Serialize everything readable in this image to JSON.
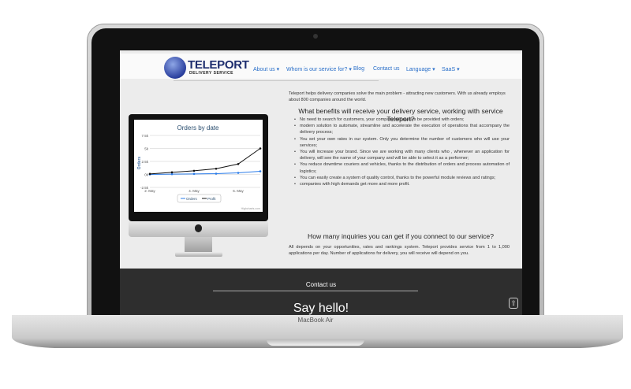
{
  "device": {
    "label": "MacBook Air"
  },
  "nav": {
    "logo_title": "TELEPORT",
    "logo_subtitle": "DELIVERY SERVICE",
    "items": [
      {
        "label": "About us ▾"
      },
      {
        "label": "Whom is our service for? ▾"
      },
      {
        "label": "Blog"
      },
      {
        "label": "Contact us"
      },
      {
        "label": "Language ▾"
      },
      {
        "label": "SaaS ▾"
      }
    ]
  },
  "intro": "Teleport helps delivery companies solve the main problem - attracting new customers. With us already employs about 800 companies around the world.",
  "benefits_heading": "What benefits will receive your delivery service, working with service Teleport?",
  "benefits": [
    "No need to search for customers, your company will always be provided with orders;",
    "modern solution to automate, streamline and accelerate the execution of operations that accompany the delivery process;",
    "You set your own rates in our system. Only you determine the number of customers who will use your services;",
    "You will increase your brand. Since we are working with many clients who , whenever an application for delivery, will see the name of your company and will be able to select it as a performer;",
    "You reduce downtime couriers and vehicles, thanks to the distribution of orders and process automation of logistics;",
    "You can easily create a system of quality control, thanks to the powerful module reviews and ratings;",
    "companies with high demands get more and more profit."
  ],
  "inquiries_heading": "How many inquiries you can get if you connect to our service?",
  "inquiries_text": "All depends on your opportunities, rates and rankings system. Teleport provides service from 1 to 1,000 applications per day. Number of applications for delivery, you will receive will depend on you.",
  "footer": {
    "title": "Contact us",
    "headline": "Say hello!"
  },
  "chart_data": {
    "type": "line",
    "title": "Orders by date",
    "ylabel": "Orders",
    "ylim": [
      -2500,
      7500
    ],
    "yticks": [
      "7.5k",
      "5k",
      "2.5k",
      "0k",
      "-2.5k"
    ],
    "xticks": [
      "2. May",
      "4. May",
      "6. May"
    ],
    "x": [
      "2. May",
      "3. May",
      "4. May",
      "5. May",
      "6. May",
      "7. May"
    ],
    "series": [
      {
        "name": "Orders",
        "color": "#2b7ce9",
        "values": [
          0,
          50,
          100,
          150,
          300,
          600
        ]
      },
      {
        "name": "Profit",
        "color": "#111111",
        "values": [
          100,
          400,
          700,
          1100,
          2000,
          5000
        ]
      }
    ],
    "credit": "Highcharts.com",
    "legend": "bottom"
  }
}
